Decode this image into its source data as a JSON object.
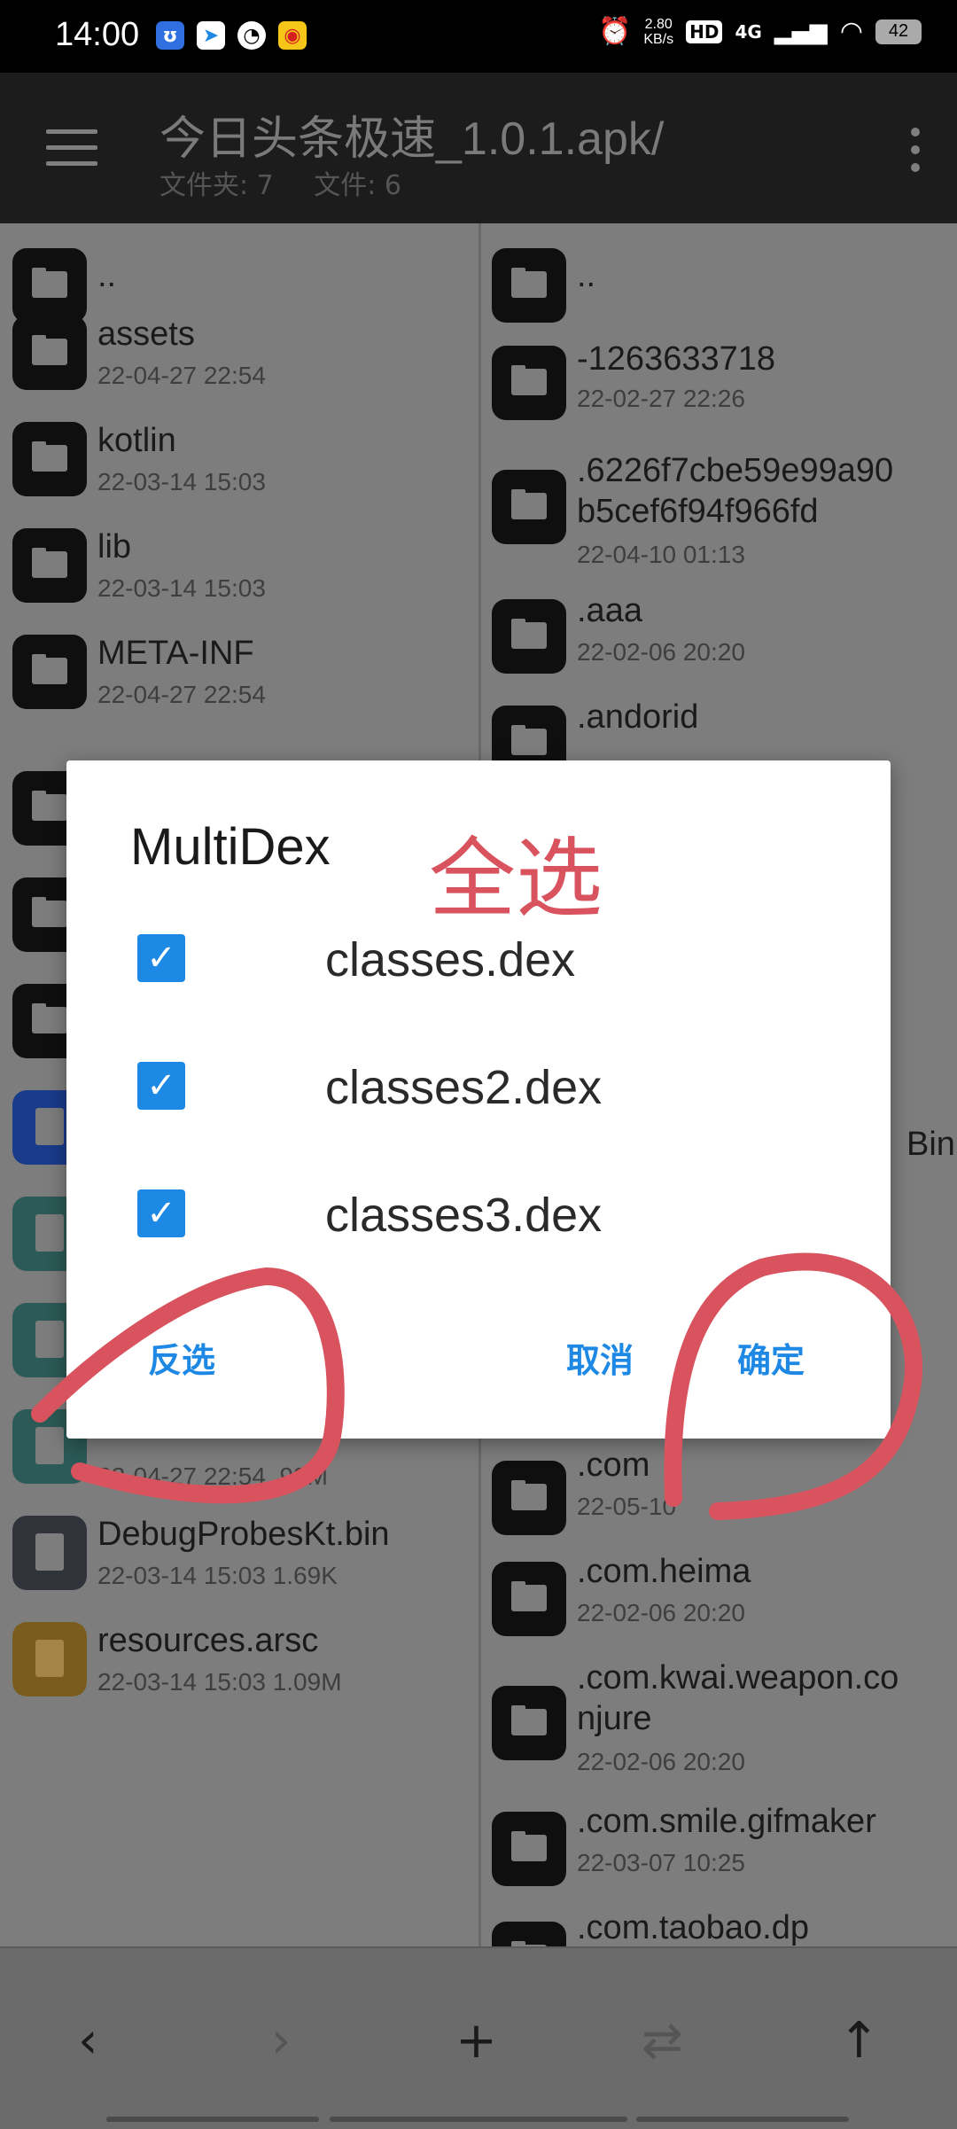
{
  "status_bar": {
    "time": "14:00",
    "net_speed_value": "2.80",
    "net_speed_unit": "KB/s",
    "hd": "HD",
    "network": "4G",
    "battery": "42"
  },
  "toolbar": {
    "title": "今日头条极速_1.0.1.apk/",
    "folders_label": "文件夹: 7",
    "files_label": "文件: 6"
  },
  "left_pane": [
    {
      "name": "..",
      "date": ""
    },
    {
      "name": "assets",
      "date": "22-04-27  22:54"
    },
    {
      "name": "kotlin",
      "date": "22-03-14  15:03"
    },
    {
      "name": "lib",
      "date": "22-03-14  15:03"
    },
    {
      "name": "META-INF",
      "date": "22-04-27  22:54"
    },
    {
      "name": "",
      "date": "22-04-27  22:54  .92M"
    },
    {
      "name": "DebugProbesKt.bin",
      "date": "22-03-14  15:03  1.69K"
    },
    {
      "name": "resources.arsc",
      "date": "22-03-14  15:03  1.09M"
    }
  ],
  "right_pane": [
    {
      "name": "..",
      "date": ""
    },
    {
      "name": "-1263633718",
      "date": "22-02-27  22:26"
    },
    {
      "name": ".6226f7cbe59e99a90",
      "name2": "b5cef6f94f966fd",
      "date": "22-04-10  01:13"
    },
    {
      "name": ".aaa",
      "date": "22-02-06  20:20"
    },
    {
      "name": ".andorid",
      "date": ""
    },
    {
      "name": "Bin",
      "date": ""
    },
    {
      "name": ".com",
      "date": "22-05-10"
    },
    {
      "name": ".com.heima",
      "date": "22-02-06  20:20"
    },
    {
      "name": ".com.kwai.weapon.co",
      "name2": "njure",
      "date": "22-02-06  20:20"
    },
    {
      "name": ".com.smile.gifmaker",
      "date": "22-03-07  10:25"
    },
    {
      "name": ".com.taobao.dp",
      "date": ""
    }
  ],
  "dialog": {
    "title": "MultiDex",
    "options": [
      {
        "label": "classes.dex",
        "checked": true
      },
      {
        "label": "classes2.dex",
        "checked": true
      },
      {
        "label": "classes3.dex",
        "checked": true
      }
    ],
    "invert_label": "反选",
    "cancel_label": "取消",
    "ok_label": "确定"
  },
  "annotation": {
    "text": "全选",
    "color": "#d9535f"
  },
  "bottom_nav": {
    "back": "‹",
    "forward": "›",
    "add": "+",
    "swap": "⇄",
    "up": "↑"
  },
  "colors": {
    "accent": "#1e88e5",
    "dim_overlay": "#7d7d7d",
    "annotation": "#d9535f"
  }
}
